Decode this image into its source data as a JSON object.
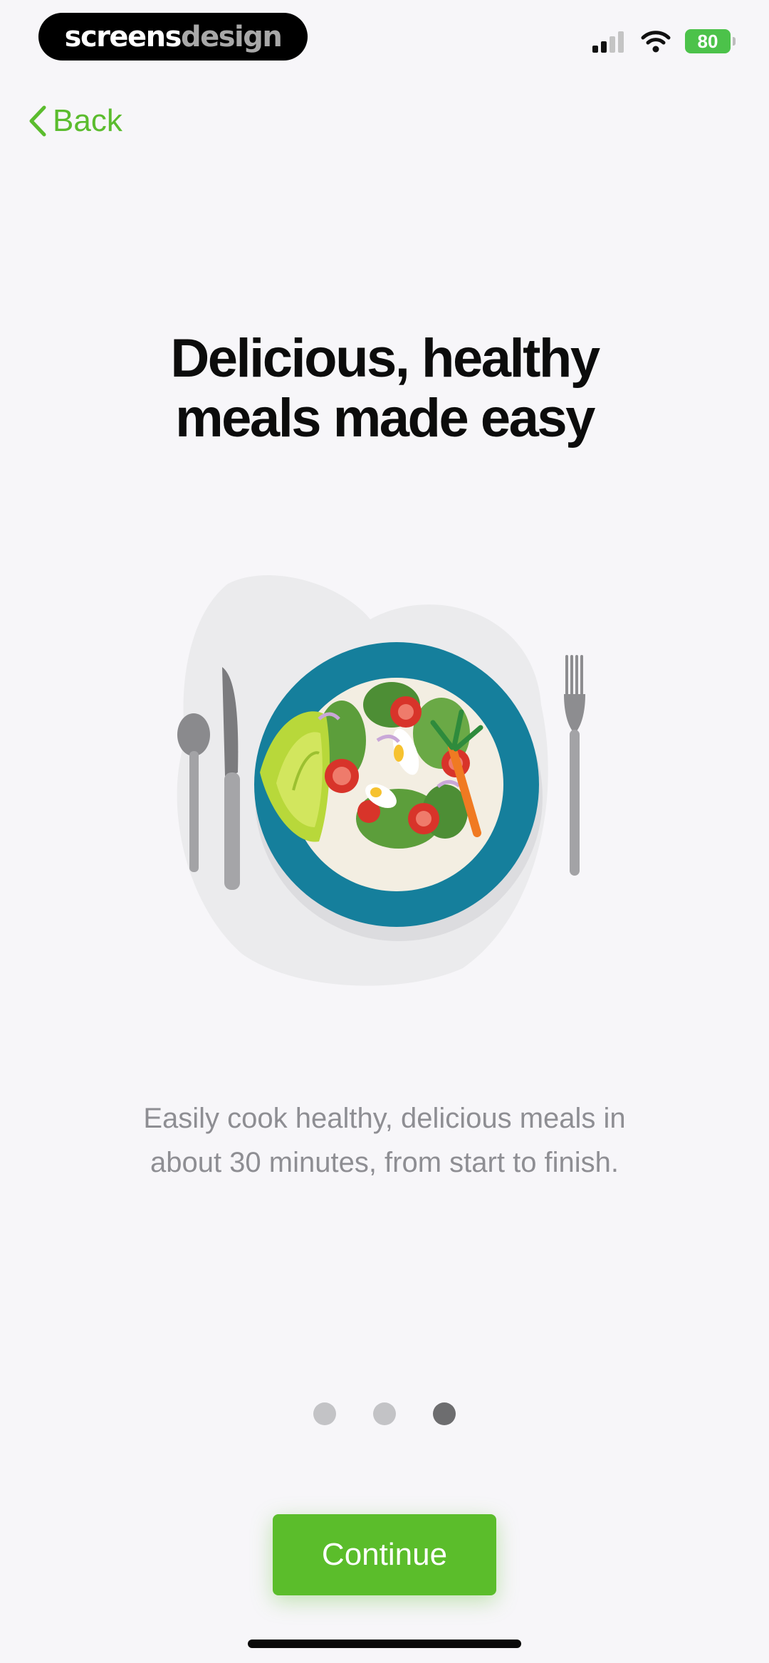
{
  "status_bar": {
    "watermark_bold": "screens",
    "watermark_light": "design",
    "battery_level": "80",
    "signal_bars_active": 2,
    "signal_bars_total": 4,
    "icons": [
      "cellular-signal-icon",
      "wifi-icon",
      "battery-charging-icon"
    ]
  },
  "nav": {
    "back_label": "Back",
    "back_icon": "chevron-left-icon"
  },
  "content": {
    "title": "Delicious, healthy\nmeals made easy",
    "subtitle": "Easily cook healthy, delicious meals in\nabout 30 minutes, from start to finish.",
    "illustration": "salad-plate-illustration"
  },
  "pagination": {
    "total_pages": 3,
    "current_page": 3
  },
  "actions": {
    "continue_label": "Continue"
  },
  "colors": {
    "accent": "#5bbd2b",
    "background": "#f7f6f9",
    "title_text": "#0c0c0c",
    "subtitle_text": "#8e8e93",
    "dot_inactive": "#c3c3c6",
    "dot_active": "#6d6d6f",
    "plate_rim": "#157f9c",
    "battery": "#4cc24a"
  }
}
